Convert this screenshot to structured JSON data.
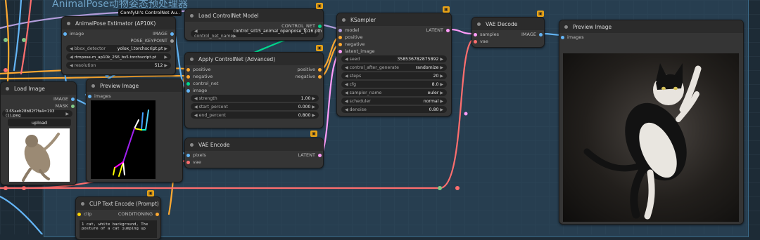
{
  "group": {
    "title": "AnimalPose动物姿态预处理器"
  },
  "tooltip": "ComfyUI's ControlNet Au..",
  "nodes": {
    "animalpose": {
      "title": "AnimalPose Estimator (AP10K)",
      "input_image": "image",
      "out_image": "IMAGE",
      "out_pose": "POSE_KEYPOINT",
      "bbox_label": "bbox_detector",
      "bbox_value": "yolox_l.torchscript.pt",
      "pose_label": "pose_estimator",
      "pose_value": "rtmpose-m_ap10k_256_bs5.torchscript.pt",
      "res_label": "resolution",
      "res_value": "512"
    },
    "load_controlnet": {
      "title": "Load ControlNet Model",
      "out": "CONTROL_NET",
      "name_label": "control_net_name",
      "name_value": "control_sd15_animal_openpose_fp16.pth"
    },
    "apply_controlnet": {
      "title": "Apply ControlNet (Advanced)",
      "in_positive": "positive",
      "in_negative": "negative",
      "in_control_net": "control_net",
      "in_image": "image",
      "out_positive": "positive",
      "out_negative": "negative",
      "strength_label": "strength",
      "strength_value": "1.00",
      "start_label": "start_percent",
      "start_value": "0.000",
      "end_label": "end_percent",
      "end_value": "0.800"
    },
    "ksampler": {
      "title": "KSampler",
      "in_model": "model",
      "in_positive": "positive",
      "in_negative": "negative",
      "in_latent": "latent_image",
      "out": "LATENT",
      "seed_label": "seed",
      "seed_value": "358536782875892",
      "cag_label": "control_after_generate",
      "cag_value": "randomize",
      "steps_label": "steps",
      "steps_value": "20",
      "cfg_label": "cfg",
      "cfg_value": "8.0",
      "sampler_label": "sampler_name",
      "sampler_value": "euler",
      "scheduler_label": "scheduler",
      "scheduler_value": "normal",
      "denoise_label": "denoise",
      "denoise_value": "0.80"
    },
    "vae_decode": {
      "title": "VAE Decode",
      "in_samples": "samples",
      "in_vae": "vae",
      "out": "IMAGE"
    },
    "preview_right": {
      "title": "Preview Image",
      "in_images": "images"
    },
    "load_image": {
      "title": "Load Image",
      "out_image": "IMAGE",
      "out_mask": "MASK",
      "file_value": "0.65aeb28b82f7fa4=193 (1).jpeg",
      "upload": "upload"
    },
    "preview_mid": {
      "title": "Preview Image",
      "in_images": "images"
    },
    "vae_encode": {
      "title": "VAE Encode",
      "in_pixels": "pixels",
      "in_vae": "vae",
      "out": "LATENT"
    },
    "clip_encode": {
      "title": "CLIP Text Encode (Prompt)",
      "in_clip": "clip",
      "out": "CONDITIONING",
      "text": "1 cat, white background, The posture of a cat jumping up"
    }
  },
  "colors": {
    "image": "#64b5f6",
    "latent": "#ff9cf9",
    "conditioning": "#ffa931",
    "control_net": "#00d78d",
    "vae": "#ff6e6e",
    "model": "#b39ddb",
    "clip": "#ffd500",
    "mask": "#81c784",
    "pose": "#9e9e9e"
  }
}
